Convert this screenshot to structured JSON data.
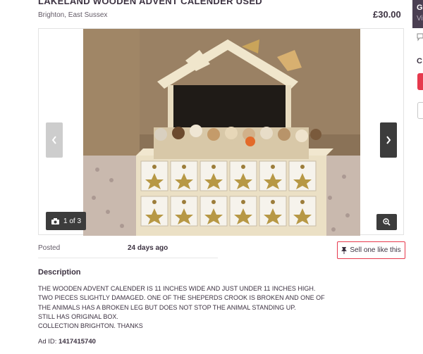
{
  "listing": {
    "title": "LAKELAND WOODEN ADVENT CALENDER USED",
    "location": "Brighton, East Sussex",
    "price": "£30.00"
  },
  "gallery": {
    "counter": "1 of 3",
    "camera_icon": "camera-icon",
    "prev_icon": "chevron-left-icon",
    "next_icon": "chevron-right-icon",
    "zoom_icon": "zoom-in-icon"
  },
  "details": {
    "posted_label": "Posted",
    "posted_value": "24 days ago"
  },
  "sell_button": {
    "label": "Sell one like this",
    "icon": "pin-icon"
  },
  "description": {
    "heading": "Description",
    "lines": [
      "THE WOODEN ADVENT CALENDER IS 11 INCHES WIDE AND JUST UNDER 11 INCHES HIGH.",
      "TWO PIECES SLIGHTLY DAMAGED. ONE OF THE SHEPERDS CROOK IS BROKEN AND ONE OF",
      "THE ANIMALS HAS A BROKEN LEG BUT DOES NOT STOP THE ANIMAL STANDING UP.",
      "STILL HAS ORIGINAL BOX.",
      "COLLECTION BRIGHTON. THANKS"
    ]
  },
  "ad_id": {
    "label": "Ad ID:",
    "value": "1417415740"
  },
  "sidebar": {
    "letter_top": "G",
    "letter_sub": "Vi",
    "letter_c": "C"
  },
  "colors": {
    "accent": "#e6394d",
    "sidebar_dark": "#4a3f52",
    "text": "#3c3241"
  }
}
